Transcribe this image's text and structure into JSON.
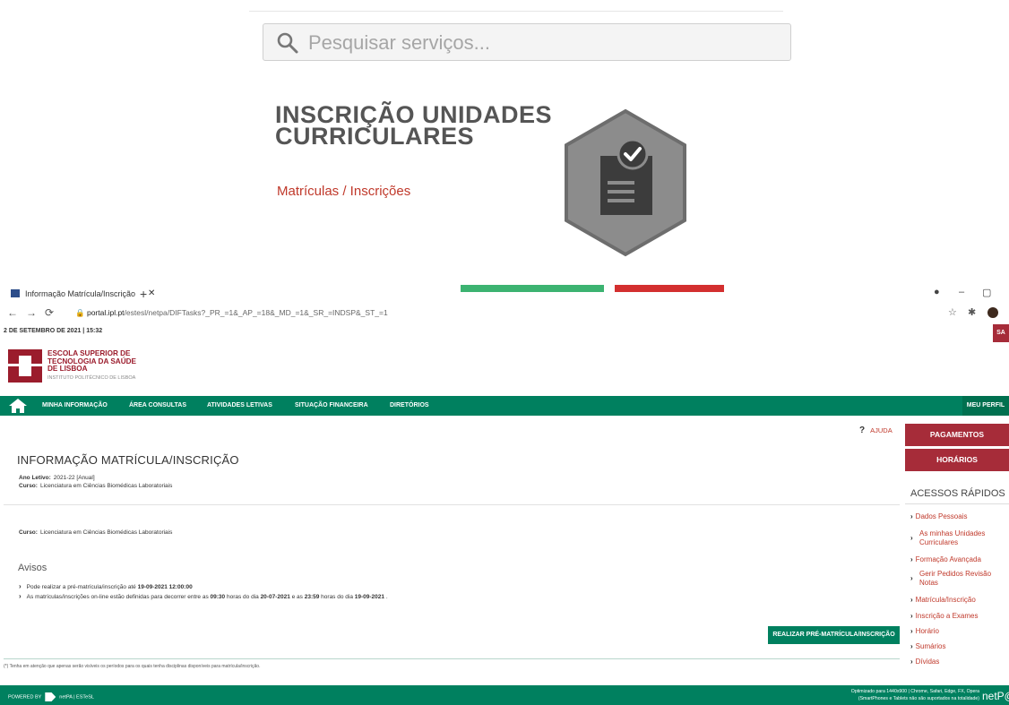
{
  "search": {
    "placeholder": "Pesquisar serviços..."
  },
  "uc_card": {
    "title_line1": "INSCRIÇÃO UNIDADES",
    "title_line2": "CURRICULARES",
    "breadcrumb": "Matrículas / Inscrições"
  },
  "browser": {
    "tab_title": "Informação Matrícula/Inscrição",
    "url_domain": "portal.ipl.pt",
    "url_path": "/estesl/netpa/DIFTasks?_PR_=1&_AP_=18&_MD_=1&_SR_=INDSP&_ST_=1"
  },
  "header": {
    "date": "2 DE SETEMBRO DE 2021 | 15:32",
    "sair": "SA",
    "school_line1": "ESCOLA SUPERIOR DE",
    "school_line2": "TECNOLOGIA DA SAÚDE",
    "school_line3": "DE LISBOA",
    "school_sub": "INSTITUTO POLITÉCNICO DE LISBOA"
  },
  "nav": {
    "items": [
      "MINHA INFORMAÇÃO",
      "ÁREA CONSULTAS",
      "ATIVIDADES LETIVAS",
      "SITUAÇÃO FINANCEIRA",
      "DIRETÓRIOS"
    ],
    "perfil": "MEU PERFIL"
  },
  "help": {
    "label": "AJUDA"
  },
  "sidebar": {
    "buttons": [
      "PAGAMENTOS",
      "HORÁRIOS"
    ],
    "quick_title": "ACESSOS RÁPIDOS",
    "links": [
      "Dados Pessoais",
      "As minhas Unidades Curriculares",
      "Formação Avançada",
      "Gerir Pedidos Revisão Notas",
      "Matrícula/Inscrição",
      "Inscrição a Exames",
      "Horário",
      "Sumários",
      "Dívidas"
    ]
  },
  "main": {
    "title": "INFORMAÇÃO MATRÍCULA/INSCRIÇÃO",
    "ano_label": "Ano Letivo:",
    "ano_value": "2021-22 [Anual]",
    "curso_label": "Curso:",
    "curso_value": "Licenciatura em Ciências Biomédicas Laboratoriais",
    "avisos_title": "Avisos",
    "aviso1_text": "Pode realizar a pré-matrícula/inscrição até",
    "aviso1_date": "19-09-2021 12:00:00",
    "aviso2_a": "As matrículas/inscrições on-line estão definidas para decorrer entre as",
    "aviso2_t1": "09:30",
    "aviso2_b": "horas do dia",
    "aviso2_d1": "20-07-2021",
    "aviso2_c": "e as",
    "aviso2_t2": "23:59",
    "aviso2_d": "horas do dia",
    "aviso2_d2": "19-09-2021",
    "action_button": "REALIZAR PRÉ-MATRÍCULA/INSCRIÇÃO",
    "note": "(*) Tenha em atenção que apenas serão visíveis os períodos para os quais tenha disciplinas disponíveis para matrícula/inscrição."
  },
  "footer": {
    "powered": "POWERED BY",
    "brand": "netPA | ESTeSL",
    "opt_line1": "Optimizado para 1440x900 | Chrome, Safari, Edge, FX, Opera",
    "opt_line2": "(SmartPhones e Tablets não são suportados na totalidade)",
    "netp": "netP@"
  }
}
